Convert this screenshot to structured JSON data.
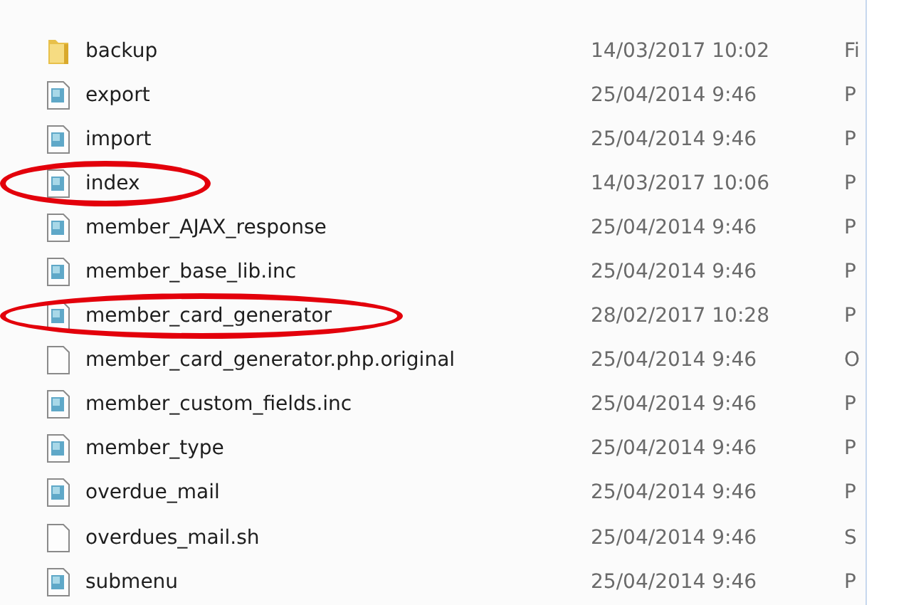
{
  "files": [
    {
      "kind": "folder",
      "name": "backup",
      "date_modified": "14/03/2017 10:02",
      "type": "Fi",
      "circled": false
    },
    {
      "kind": "script",
      "name": "export",
      "date_modified": "25/04/2014 9:46",
      "type": "P",
      "circled": false
    },
    {
      "kind": "script",
      "name": "import",
      "date_modified": "25/04/2014 9:46",
      "type": "P",
      "circled": false
    },
    {
      "kind": "script",
      "name": "index",
      "date_modified": "14/03/2017 10:06",
      "type": "P",
      "circled": true
    },
    {
      "kind": "script",
      "name": "member_AJAX_response",
      "date_modified": "25/04/2014 9:46",
      "type": "P",
      "circled": false
    },
    {
      "kind": "script",
      "name": "member_base_lib.inc",
      "date_modified": "25/04/2014 9:46",
      "type": "P",
      "circled": false
    },
    {
      "kind": "script",
      "name": "member_card_generator",
      "date_modified": "28/02/2017 10:28",
      "type": "P",
      "circled": true
    },
    {
      "kind": "plain",
      "name": "member_card_generator.php.original",
      "date_modified": "25/04/2014 9:46",
      "type": "O",
      "circled": false
    },
    {
      "kind": "script",
      "name": "member_custom_fields.inc",
      "date_modified": "25/04/2014 9:46",
      "type": "P",
      "circled": false
    },
    {
      "kind": "script",
      "name": "member_type",
      "date_modified": "25/04/2014 9:46",
      "type": "P",
      "circled": false
    },
    {
      "kind": "script",
      "name": "overdue_mail",
      "date_modified": "25/04/2014 9:46",
      "type": "P",
      "circled": false
    },
    {
      "kind": "plain",
      "name": "overdues_mail.sh",
      "date_modified": "25/04/2014 9:46",
      "type": "S",
      "circled": false
    },
    {
      "kind": "script",
      "name": "submenu",
      "date_modified": "25/04/2014 9:46",
      "type": "P",
      "circled": false
    }
  ]
}
